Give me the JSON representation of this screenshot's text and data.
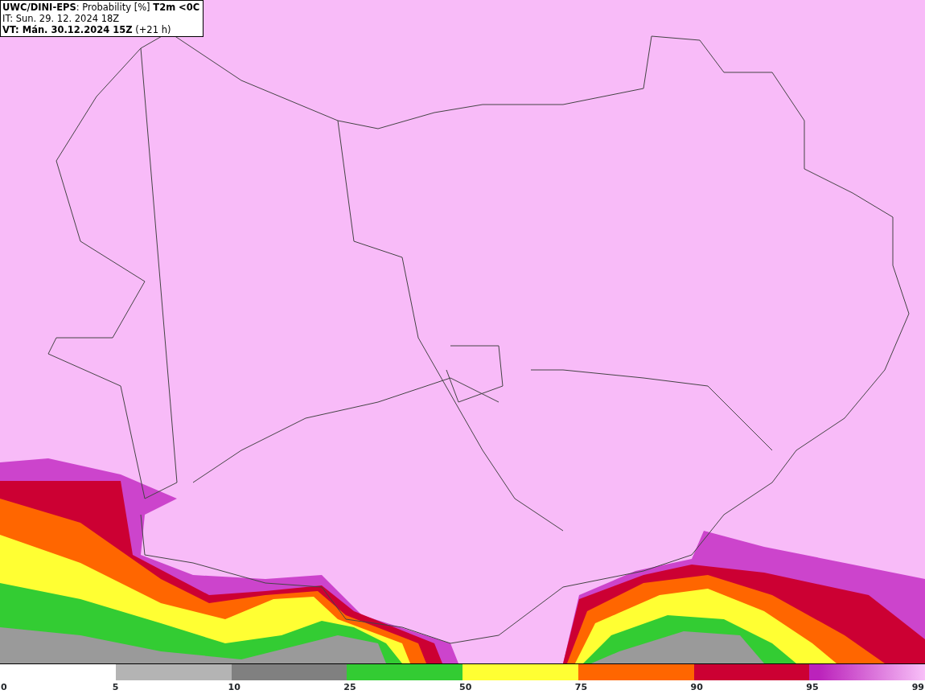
{
  "header": {
    "lines": [
      "**UWC/DINI-EPS**: Probability [%] **T2m <0C**",
      "IT: Sun. 29. 12. 2024 18Z",
      "**VT: Mán. 30.12.2024 15Z** (+21 h)"
    ]
  },
  "legend": {
    "segments": [
      {
        "label": "0"
      },
      {
        "color": "#b4b4b4",
        "label": "5"
      },
      {
        "color": "#808080",
        "label": "10"
      },
      {
        "color": "#33cc33",
        "label": "25"
      },
      {
        "color": "#ffff33",
        "label": "50"
      },
      {
        "color": "#ff6600",
        "label": "75"
      },
      {
        "color": "#cc0033",
        "label": "90"
      },
      {
        "color": "#bb22bb",
        "kind": "gradient",
        "label": "95"
      }
    ],
    "end_label": "99"
  }
}
